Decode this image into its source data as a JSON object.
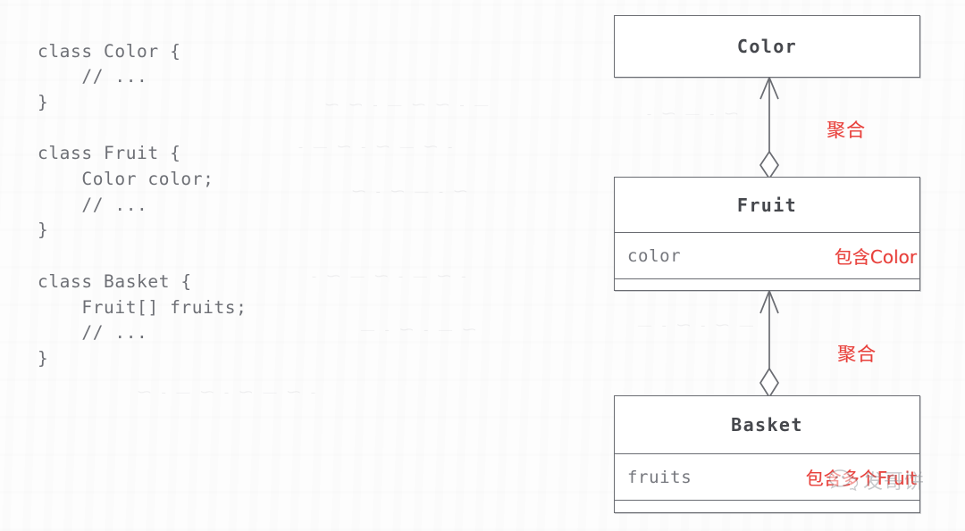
{
  "page": {
    "background_color": "#fdfdfd",
    "ink_color": "#6e7076",
    "accent_red": "#e8413c",
    "line_color": "#6a6c72"
  },
  "code_listing": {
    "language": "java",
    "lines": [
      "class Color {",
      "    // ...",
      "}",
      "",
      "class Fruit {",
      "    Color color;",
      "    // ...",
      "}",
      "",
      "class Basket {",
      "    Fruit[] fruits;",
      "    // ...",
      "}"
    ]
  },
  "diagram": {
    "type": "uml-class-diagram",
    "classes": [
      {
        "id": "color",
        "name": "Color",
        "attributes": [],
        "note": "",
        "has_empty_compartment": false
      },
      {
        "id": "fruit",
        "name": "Fruit",
        "attributes": [
          "color"
        ],
        "note": "包含Color",
        "has_empty_compartment": true
      },
      {
        "id": "basket",
        "name": "Basket",
        "attributes": [
          "fruits"
        ],
        "note": "包含多个Fruit",
        "has_empty_compartment": true
      }
    ],
    "relations": [
      {
        "id": "fruit-color",
        "kind": "aggregation",
        "from": "Fruit",
        "to": "Color",
        "label": "聚合",
        "arrow_end": "open-arrow",
        "diamond_end": "hollow-diamond"
      },
      {
        "id": "basket-fruit",
        "kind": "aggregation",
        "from": "Basket",
        "to": "Fruit",
        "label": "聚合",
        "arrow_end": "open-arrow",
        "diamond_end": "hollow-diamond"
      }
    ]
  },
  "watermark": {
    "icon": "wechat-speech-bubble-icon",
    "text": "发哥饼"
  }
}
